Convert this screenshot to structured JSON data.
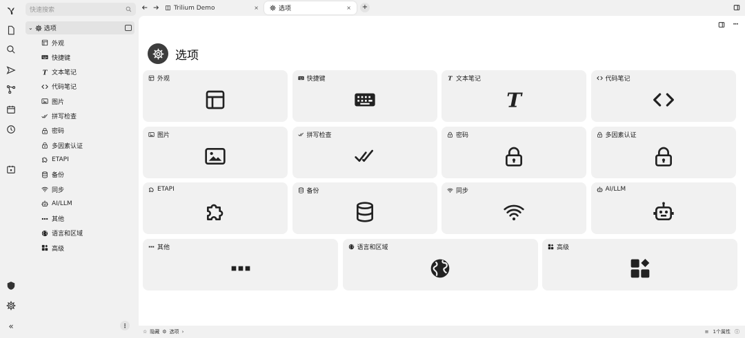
{
  "search": {
    "placeholder": "快速搜索"
  },
  "tree": {
    "root": "选项",
    "items": [
      {
        "label": "外观",
        "icon": "layout-icon"
      },
      {
        "label": "快捷键",
        "icon": "keyboard-icon"
      },
      {
        "label": "文本笔记",
        "icon": "text-icon"
      },
      {
        "label": "代码笔记",
        "icon": "code-icon"
      },
      {
        "label": "图片",
        "icon": "image-icon"
      },
      {
        "label": "拼写检查",
        "icon": "check-double-icon"
      },
      {
        "label": "密码",
        "icon": "lock-icon"
      },
      {
        "label": "多因素认证",
        "icon": "lock-icon"
      },
      {
        "label": "ETAPI",
        "icon": "puzzle-icon"
      },
      {
        "label": "备份",
        "icon": "database-icon"
      },
      {
        "label": "同步",
        "icon": "wifi-icon"
      },
      {
        "label": "AI/LLM",
        "icon": "robot-icon"
      },
      {
        "label": "其他",
        "icon": "dots-icon"
      },
      {
        "label": "语言和区域",
        "icon": "globe-icon"
      },
      {
        "label": "高级",
        "icon": "apps-icon"
      }
    ]
  },
  "tabs": [
    {
      "label": "Trilium Demo",
      "close": "×"
    },
    {
      "label": "选项",
      "close": "×"
    }
  ],
  "page": {
    "title": "选项"
  },
  "cards": [
    {
      "label": "外观",
      "icon": "layout-icon"
    },
    {
      "label": "快捷键",
      "icon": "keyboard-icon"
    },
    {
      "label": "文本笔记",
      "icon": "text-icon"
    },
    {
      "label": "代码笔记",
      "icon": "code-icon"
    },
    {
      "label": "图片",
      "icon": "image-icon"
    },
    {
      "label": "拼写检查",
      "icon": "check-double-icon"
    },
    {
      "label": "密码",
      "icon": "lock-icon"
    },
    {
      "label": "多因素认证",
      "icon": "lock-icon"
    },
    {
      "label": "ETAPI",
      "icon": "puzzle-icon"
    },
    {
      "label": "备份",
      "icon": "database-icon"
    },
    {
      "label": "同步",
      "icon": "wifi-icon"
    },
    {
      "label": "AI/LLM",
      "icon": "robot-icon"
    },
    {
      "label": "其他",
      "icon": "dots-icon"
    },
    {
      "label": "语言和区域",
      "icon": "globe-icon"
    },
    {
      "label": "高级",
      "icon": "apps-icon"
    }
  ],
  "statusbar": {
    "breadcrumb": [
      "隐藏",
      "选项"
    ],
    "attributes": "1个属性"
  },
  "colors": {
    "accent": "#3d3d3d",
    "card_bg": "#f1f1f1",
    "sidebar_bg": "#f1f1f1",
    "content_bg": "#ffffff"
  }
}
